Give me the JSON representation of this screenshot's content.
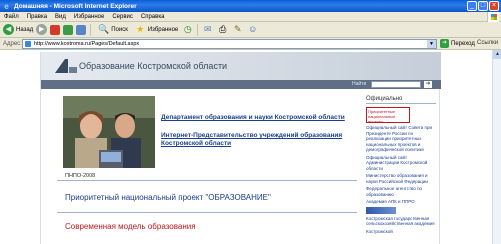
{
  "window": {
    "title": "Домашняя - Microsoft Internet Explorer",
    "controls": {
      "minimize": "_",
      "maximize": "□",
      "close": "×"
    }
  },
  "menu": [
    "Файл",
    "Правка",
    "Вид",
    "Избранное",
    "Сервис",
    "Справка"
  ],
  "toolbar": {
    "back_label": "Назад",
    "search_label": "Поиск",
    "favorites_label": "Избранное"
  },
  "address": {
    "label": "Адрес:",
    "url": "http://www.kostroma.ru/Pages/Default.aspx",
    "go_label": "Переход",
    "links_label": "Ссылки"
  },
  "page": {
    "site_title": "Образование Костромской области",
    "search_label": "Найти",
    "ministry_link": "Департамент образования и науки Костромской области",
    "portal_link": "Интернет-Представительство учреждений образования Костромской области",
    "pnpo": "ПНПО-2008",
    "project_title": "Приоритетный национальный проект \"ОБРАЗОВАНИЕ\"",
    "model_title": "Современная модель образования",
    "sidebar": {
      "heading": "Официально",
      "banner": "Приоритетные национальные проекты",
      "links": [
        "Официальный сайт Совета при Президенте России по реализации приоритетных национальных проектов и демографической политике",
        "Официальный сайт Администрации Костромской области",
        "Министерство образования и науки Российской Федерации",
        "Федеральное агентство по образованию",
        "Академия АПК и ППРО",
        "Костромская государственная сельскохозяйственная академия",
        "Костромской"
      ]
    }
  },
  "colors": {
    "title_bar": "#0a5fd6",
    "link": "#1b3f8f",
    "accent_red": "#c0181f",
    "header_bar": "#5f6f86"
  },
  "icons": [
    "ie-logo-icon",
    "back-arrow-icon",
    "forward-arrow-icon",
    "stop-icon",
    "refresh-icon",
    "home-icon",
    "search-icon",
    "favorites-star-icon",
    "history-icon",
    "mail-icon",
    "print-icon",
    "edit-icon",
    "messenger-icon",
    "page-icon",
    "go-arrow-icon"
  ]
}
